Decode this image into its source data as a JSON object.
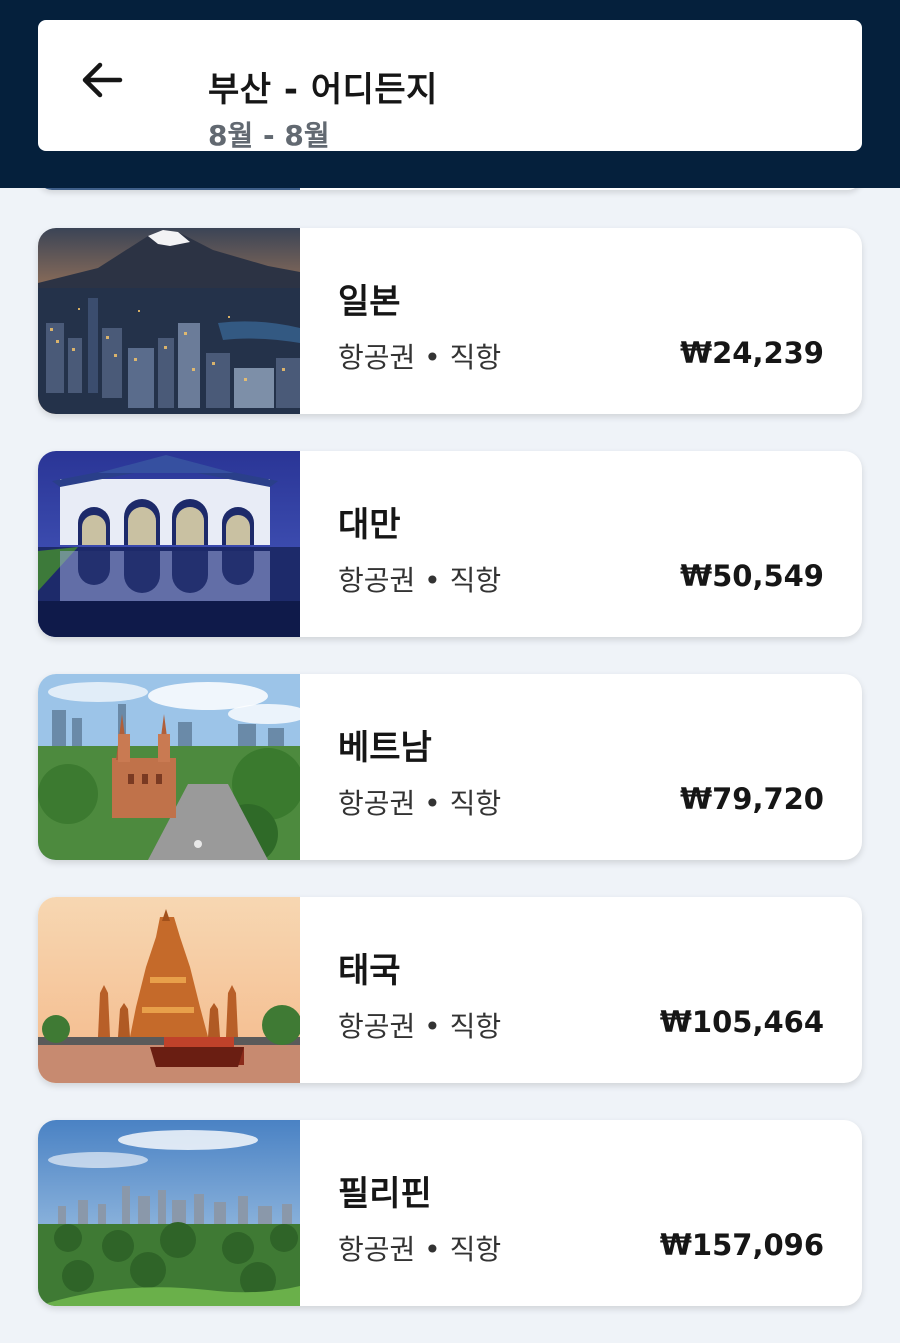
{
  "header": {
    "route": "부산 - 어디든지",
    "dates": "8월 - 8월",
    "back_icon": "arrow-left-icon"
  },
  "colors": {
    "header_bg": "#05203c",
    "page_bg": "#eff3f8",
    "card_bg": "#ffffff",
    "text_primary": "#161616",
    "text_secondary": "#626971"
  },
  "destinations": [
    {
      "name": "일본",
      "subtitle": "항공권 • 직항",
      "price": "₩24,239",
      "image": "fuji-city-image"
    },
    {
      "name": "대만",
      "subtitle": "항공권 • 직항",
      "price": "₩50,549",
      "image": "memorial-gate-image"
    },
    {
      "name": "베트남",
      "subtitle": "항공권 • 직항",
      "price": "₩79,720",
      "image": "saigon-cathedral-image"
    },
    {
      "name": "태국",
      "subtitle": "항공권 • 직항",
      "price": "₩105,464",
      "image": "wat-arun-image"
    },
    {
      "name": "필리핀",
      "subtitle": "항공권 • 직항",
      "price": "₩157,096",
      "image": "manila-skyline-image"
    }
  ]
}
